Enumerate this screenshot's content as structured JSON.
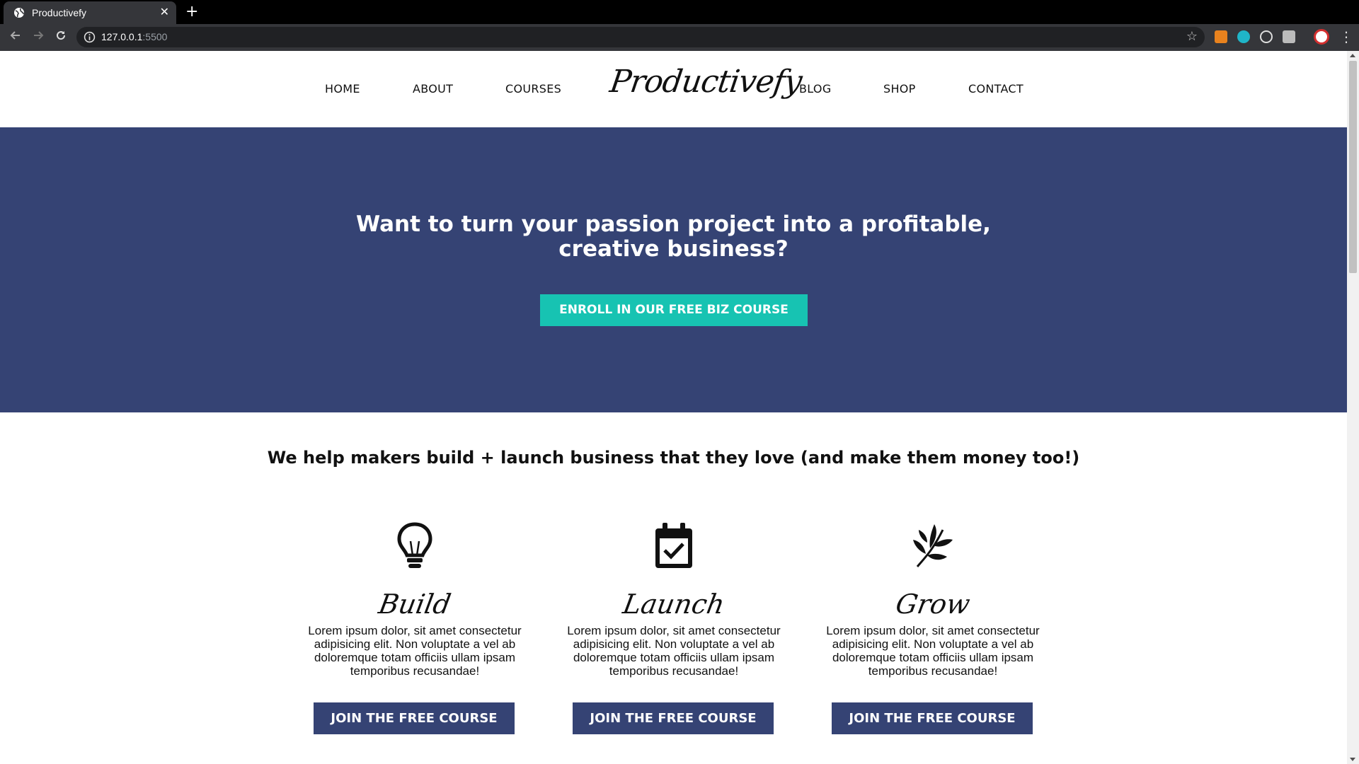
{
  "browser": {
    "tab_title": "Productivefy",
    "tab_close": "✕",
    "new_tab": "+",
    "url_host": "127.0.0.1",
    "url_port": ":5500",
    "star": "☆",
    "menu": "⋮"
  },
  "nav": {
    "items": [
      "HOME",
      "ABOUT",
      "COURSES",
      "BLOG",
      "SHOP",
      "CONTACT"
    ],
    "logo": "Productivefy"
  },
  "hero": {
    "title": "Want to turn your passion project into a profitable, creative business?",
    "button": "ENROLL IN OUR FREE BIZ COURSE",
    "background": "#354374",
    "button_color": "#17c3b2"
  },
  "tagline": "We help makers build + launch business that they love (and make them money too!)",
  "features": [
    {
      "icon": "lightbulb-icon",
      "title": "Build",
      "text": "Lorem ipsum dolor, sit amet consectetur adipisicing elit. Non voluptate a vel ab doloremque totam officiis ullam ipsam temporibus recusandae!",
      "button": "JOIN THE FREE COURSE"
    },
    {
      "icon": "calendar-check-icon",
      "title": "Launch",
      "text": "Lorem ipsum dolor, sit amet consectetur adipisicing elit. Non voluptate a vel ab doloremque totam officiis ullam ipsam temporibus recusandae!",
      "button": "JOIN THE FREE COURSE"
    },
    {
      "icon": "leaf-icon",
      "title": "Grow",
      "text": "Lorem ipsum dolor, sit amet consectetur adipisicing elit. Non voluptate a vel ab doloremque totam officiis ullam ipsam temporibus recusandae!",
      "button": "JOIN THE FREE COURSE"
    }
  ]
}
